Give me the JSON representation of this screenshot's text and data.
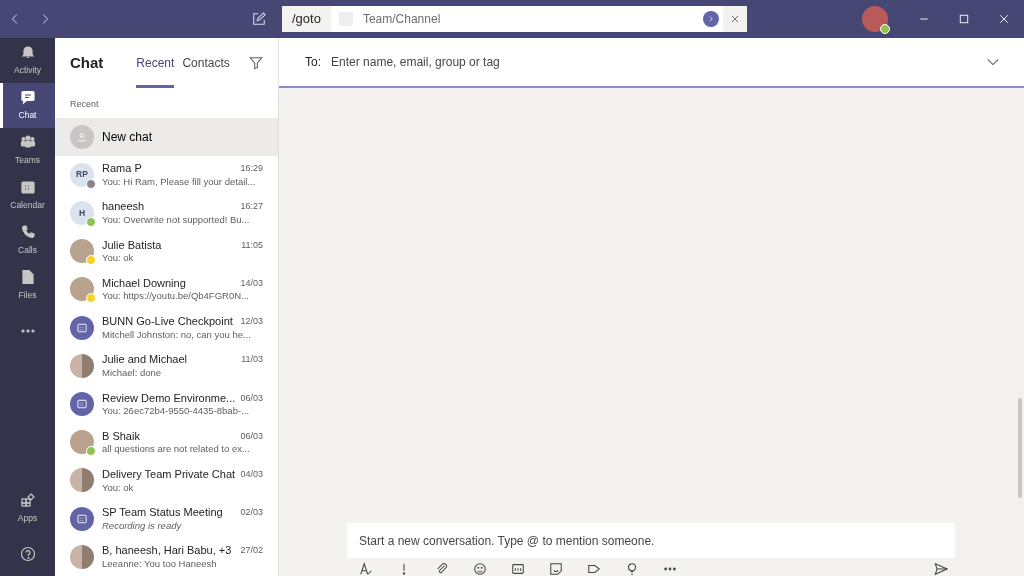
{
  "top_bar": {
    "command": "/goto",
    "search_placeholder": "Team/Channel"
  },
  "app_rail": [
    {
      "kind": "bell",
      "label": "Activity",
      "selected": false
    },
    {
      "kind": "chat",
      "label": "Chat",
      "selected": true
    },
    {
      "kind": "teams",
      "label": "Teams",
      "selected": false
    },
    {
      "kind": "calendar",
      "label": "Calendar",
      "selected": false
    },
    {
      "kind": "calls",
      "label": "Calls",
      "selected": false
    },
    {
      "kind": "files",
      "label": "Files",
      "selected": false
    },
    {
      "kind": "more",
      "selected": false
    }
  ],
  "app_rail_bottom": [
    {
      "kind": "apps",
      "label": "Apps",
      "selected": false
    },
    {
      "kind": "help",
      "selected": false
    }
  ],
  "chat_list": {
    "title": "Chat",
    "tabs": [
      {
        "label": "Recent",
        "selected": true
      },
      {
        "label": "Contacts",
        "selected": false
      }
    ],
    "section_label": "Recent",
    "new_chat": "New chat",
    "items": [
      {
        "kind": "initials",
        "initials": "RP",
        "color": "#8a8886",
        "name": "Rama P",
        "time": "16:29",
        "preview": "You: Hi Ram, Please fill your detail...",
        "italic": false
      },
      {
        "kind": "initials",
        "initials": "H",
        "color": "#92c353",
        "name": "haneesh",
        "time": "16:27",
        "preview": "You: Overwrite not supported! Bu...",
        "italic": false
      },
      {
        "kind": "photo",
        "color": "#f8d22a",
        "name": "Julie Batista",
        "time": "11:05",
        "preview": "You: ok",
        "italic": false
      },
      {
        "kind": "photo",
        "color": "#f8d22a",
        "name": "Michael Downing",
        "time": "14/03",
        "preview": "You: https://youtu.be/Qb4FGR0N...",
        "italic": false
      },
      {
        "kind": "meeting",
        "name": "BUNN Go-Live Checkpoint",
        "time": "12/03",
        "preview": "Mitchell Johnston: no, can you he...",
        "italic": false
      },
      {
        "kind": "group",
        "name": "Julie and Michael",
        "time": "11/03",
        "preview": "Michael: done",
        "italic": false
      },
      {
        "kind": "meeting",
        "name": "Review Demo Environme...",
        "time": "06/03",
        "preview": "You: 26ec72b4-9550-4435-8bab-...",
        "italic": false
      },
      {
        "kind": "photo",
        "color": "#92c353",
        "name": "B Shaik",
        "time": "06/03",
        "preview": "all questions are not related to ex...",
        "italic": false
      },
      {
        "kind": "group",
        "name": "Delivery Team Private Chat",
        "time": "04/03",
        "preview": "You: ok",
        "italic": false
      },
      {
        "kind": "meeting",
        "name": "SP Team Status Meeting",
        "time": "02/03",
        "preview": "Recording is ready",
        "italic": true
      },
      {
        "kind": "group",
        "name": "B, haneesh, Hari Babu, +3",
        "time": "27/02",
        "preview": "Leeanne: You too Haneesh",
        "italic": false
      }
    ]
  },
  "compose": {
    "to_label": "To:",
    "to_placeholder": "Enter name, email, group or tag",
    "message_placeholder": "Start a new conversation. Type @ to mention someone."
  }
}
